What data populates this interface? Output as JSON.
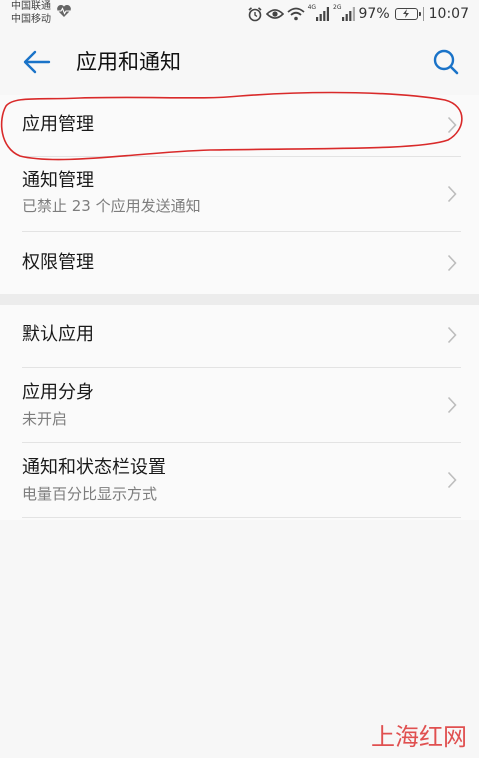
{
  "status_bar": {
    "carrier_1": "中国联通",
    "carrier_2": "中国移动",
    "net_1": "4G",
    "net_2": "2G",
    "battery": "97%",
    "time": "10:07"
  },
  "app_bar": {
    "title": "应用和通知"
  },
  "groups": [
    {
      "items": [
        {
          "title": "应用管理",
          "subtitle": ""
        },
        {
          "title": "通知管理",
          "subtitle": "已禁止 23 个应用发送通知"
        },
        {
          "title": "权限管理",
          "subtitle": ""
        }
      ]
    },
    {
      "items": [
        {
          "title": "默认应用",
          "subtitle": ""
        },
        {
          "title": "应用分身",
          "subtitle": "未开启"
        },
        {
          "title": "通知和状态栏设置",
          "subtitle": "电量百分比显示方式"
        }
      ]
    }
  ],
  "highlight_color": "#d92a2a",
  "accent_color": "#1a73c8",
  "watermark": "上海红网"
}
